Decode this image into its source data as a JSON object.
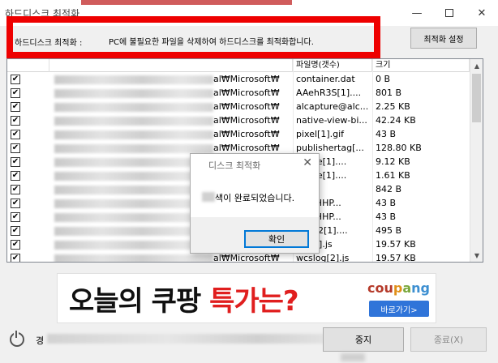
{
  "window": {
    "title": "하드디스크 최적화",
    "minimize_glyph": "—",
    "close_glyph": "✕"
  },
  "header": {
    "label": "하드디스크 최적화 :",
    "description": "PC에 불필요한 파일을 삭제하여 하드디스크를 최적화합니다.",
    "settings_button": "최적화 설정"
  },
  "table": {
    "columns": [
      "",
      "",
      "파일명(갯수)",
      "크기"
    ],
    "check_glyph": "✔",
    "rows": [
      {
        "path_suffix": "al₩Microsoft₩",
        "name": "container.dat",
        "size": "0 B"
      },
      {
        "path_suffix": "al₩Microsoft₩",
        "name": "AAehR3S[1]....",
        "size": "801 B"
      },
      {
        "path_suffix": "al₩Microsoft₩",
        "name": "alcapture@alc...",
        "size": "2.25 KB"
      },
      {
        "path_suffix": "al₩Microsoft₩",
        "name": "native-view-bi...",
        "size": "42.24 KB"
      },
      {
        "path_suffix": "al₩Microsoft₩",
        "name": "pixel[1].gif",
        "size": "43 B"
      },
      {
        "path_suffix": "al₩Microsoft₩",
        "name": "publishertag[...",
        "size": "128.80 KB"
      },
      {
        "path_suffix": "",
        "name": "frame[1]....",
        "size": "9.12 KB"
      },
      {
        "path_suffix": "",
        "name": "frame[1]....",
        "size": "1.61 KB"
      },
      {
        "path_suffix": "",
        "name": "gif",
        "size": "842 B"
      },
      {
        "path_suffix": "",
        "name": "jrMaHHP...",
        "size": "43 B"
      },
      {
        "path_suffix": "",
        "name": "jrMaHHP...",
        "size": "43 B"
      },
      {
        "path_suffix": "",
        "name": "rsion2[1]....",
        "size": "495 B"
      },
      {
        "path_suffix": "",
        "name": "log[1].js",
        "size": "19.57 KB"
      },
      {
        "path_suffix": "al₩Microsoft₩",
        "name": "wcslog[2].js",
        "size": "19.57 KB"
      }
    ],
    "scroll_up_glyph": "▲",
    "scroll_down_glyph": "▼"
  },
  "dialog": {
    "title": "디스크 최적화",
    "close_glyph": "✕",
    "message": "색이 완료되었습니다.",
    "ok_button": "확인"
  },
  "ad": {
    "headline_part1": "오늘의 쿠팡",
    "headline_part2": "특가는?",
    "brand_letters": [
      "cou",
      "p",
      "a",
      "ng"
    ],
    "cta_button": "바로가기>"
  },
  "footer": {
    "status_label": "경",
    "stop_button": "중지",
    "close_button": "종료(X)"
  }
}
